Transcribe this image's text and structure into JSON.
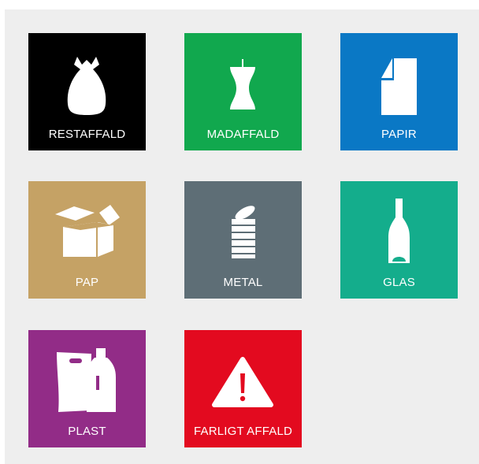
{
  "tiles": [
    {
      "label": "RESTAFFALD",
      "icon": "trash-bag-icon",
      "color": "#000000"
    },
    {
      "label": "MADAFFALD",
      "icon": "apple-core-icon",
      "color": "#11a84e"
    },
    {
      "label": "PAPIR",
      "icon": "paper-sheet-icon",
      "color": "#0a78c5"
    },
    {
      "label": "PAP",
      "icon": "cardboard-box-icon",
      "color": "#c5a265"
    },
    {
      "label": "METAL",
      "icon": "tin-can-icon",
      "color": "#5e6e76"
    },
    {
      "label": "GLAS",
      "icon": "glass-bottle-icon",
      "color": "#14ad8c"
    },
    {
      "label": "PLAST",
      "icon": "plastic-bag-bottle-icon",
      "color": "#922c87"
    },
    {
      "label": "FARLIGT AFFALD",
      "icon": "warning-triangle-icon",
      "color": "#e30a1f"
    }
  ]
}
